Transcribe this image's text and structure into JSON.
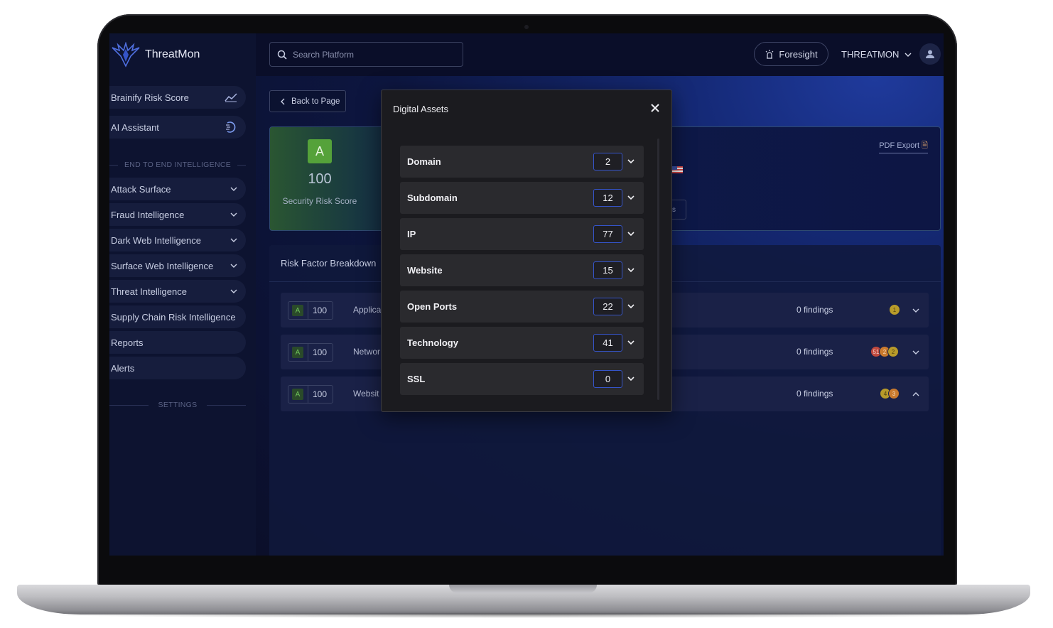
{
  "app": {
    "brand": "ThreatMon"
  },
  "search": {
    "placeholder": "Search Platform"
  },
  "topbar": {
    "foresight_label": "Foresight",
    "org_name": "THREATMON"
  },
  "sidebar": {
    "top_items": [
      {
        "label": "Brainify Risk Score"
      },
      {
        "label": "AI Assistant"
      }
    ],
    "section_label": "END TO END INTELLIGENCE",
    "items": [
      {
        "label": "Attack Surface"
      },
      {
        "label": "Fraud Intelligence"
      },
      {
        "label": "Dark Web Intelligence"
      },
      {
        "label": "Surface Web Intelligence"
      },
      {
        "label": "Threat Intelligence"
      },
      {
        "label": "Supply Chain Risk Intelligence"
      },
      {
        "label": "Reports"
      },
      {
        "label": "Alerts"
      }
    ],
    "settings_label": "SETTINGS"
  },
  "main": {
    "back_label": "Back to Page",
    "score_card": {
      "grade": "A",
      "score": "100",
      "label": "Security Risk Score",
      "pdf_export": "PDF Export",
      "mini_button": "s"
    },
    "risk_panel": {
      "title": "Risk Factor Breakdown",
      "rows": [
        {
          "grade": "A",
          "score": "100",
          "name": "Applica",
          "findings": "0 findings",
          "badges": [
            "1"
          ]
        },
        {
          "grade": "A",
          "score": "100",
          "name": "Networ",
          "findings": "0 findings",
          "badges": [
            "51",
            "2",
            "2"
          ]
        },
        {
          "grade": "A",
          "score": "100",
          "name": "Websit",
          "findings": "0 findings",
          "badges": [
            "4",
            "3"
          ]
        }
      ]
    }
  },
  "modal": {
    "title": "Digital Assets",
    "assets": [
      {
        "name": "Domain",
        "count": "2"
      },
      {
        "name": "Subdomain",
        "count": "12"
      },
      {
        "name": "IP",
        "count": "77"
      },
      {
        "name": "Website",
        "count": "15"
      },
      {
        "name": "Open Ports",
        "count": "22"
      },
      {
        "name": "Technology",
        "count": "41"
      },
      {
        "name": "SSL",
        "count": "0"
      }
    ]
  },
  "colors": {
    "accent": "#3554c9",
    "grade_green": "#55a23a",
    "modal_bg": "#1b1b1f"
  }
}
